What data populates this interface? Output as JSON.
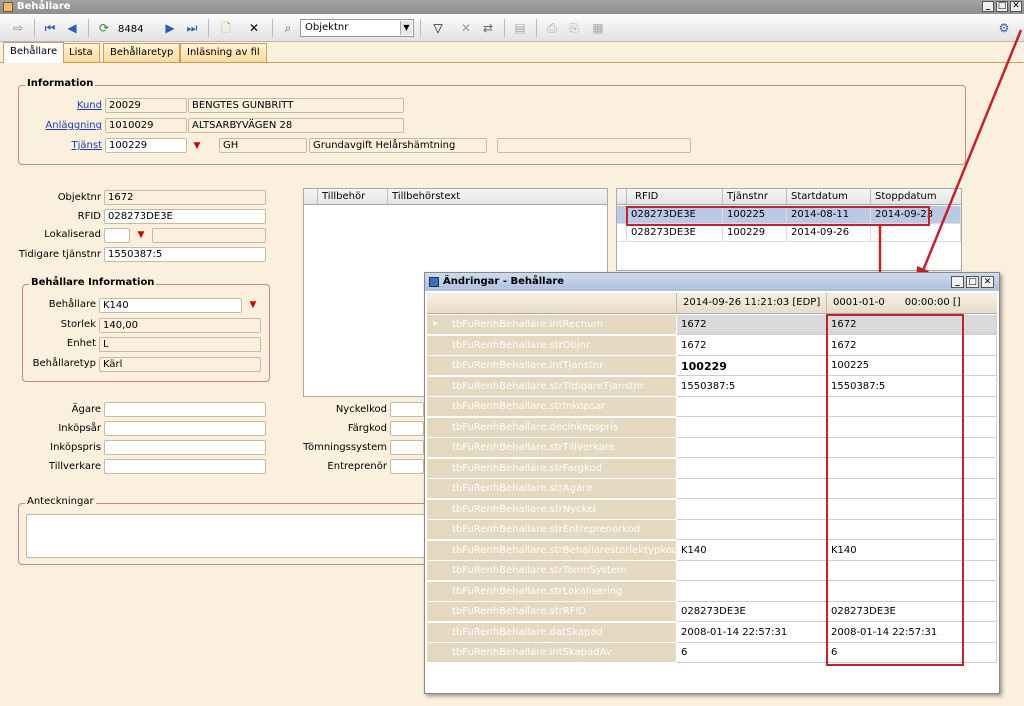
{
  "window": {
    "title": "Behållare"
  },
  "toolbar": {
    "record_number": "8484",
    "search_field": "Objektnr"
  },
  "tabs": [
    {
      "label": "Behållare",
      "active": true
    },
    {
      "label": "Lista"
    },
    {
      "label": "Behållaretyp"
    },
    {
      "label": "Inläsning av fil"
    }
  ],
  "information": {
    "title": "Information",
    "kund_label": "Kund",
    "kund_id": "20029",
    "kund_name": "BENGTES GUNBRITT",
    "anlaggning_label": "Anläggning",
    "anlaggning_id": "1010029",
    "anlaggning_name": "ALTSARBYVÄGEN 28",
    "tjanst_label": "Tjänst",
    "tjanst_id": "100229",
    "tjanst_code": "GH",
    "tjanst_desc": "Grundavgift Helårshämtning",
    "tjanst_extra": ""
  },
  "object": {
    "objektnr_label": "Objektnr",
    "objektnr": "1672",
    "rfid_label": "RFID",
    "rfid": "028273DE3E",
    "lokaliserad_label": "Lokaliserad",
    "lokaliserad": "",
    "lokaliserad_extra": "",
    "tidigare_label": "Tidigare tjänstnr",
    "tidigare": "1550387:5"
  },
  "behallare_info": {
    "title": "Behållare Information",
    "behallare_label": "Behållare",
    "behallare": "K140",
    "storlek_label": "Storlek",
    "storlek": "140,00",
    "enhet_label": "Enhet",
    "enhet": "L",
    "behallaretyp_label": "Behållaretyp",
    "behallaretyp": "Kärl"
  },
  "owner": {
    "agare_label": "Ägare",
    "agare": "",
    "inkopsar_label": "Inköpsår",
    "inkopsar": "",
    "inkopspris_label": "Inköpspris",
    "inkopspris": "",
    "tillverkare_label": "Tillverkare",
    "tillverkare": ""
  },
  "keys": {
    "nyckelkod_label": "Nyckelkod",
    "nyckelkod": "",
    "fargkod_label": "Färgkod",
    "fargkod": "",
    "tomningssystem_label": "Tömningssystem",
    "tomningssystem": "",
    "entreprenor_label": "Entreprenör",
    "entreprenor": ""
  },
  "notes": {
    "label": "Anteckningar",
    "value": ""
  },
  "accessories": {
    "col1": "Tillbehör",
    "col2": "Tillbehörstext"
  },
  "rfid_grid": {
    "headers": [
      "RFID",
      "Tjänstnr",
      "Startdatum",
      "Stoppdatum"
    ],
    "rows": [
      [
        "028273DE3E",
        "100225",
        "2014-08-11",
        "2014-09-23"
      ],
      [
        "028273DE3E",
        "100229",
        "2014-09-26",
        ""
      ]
    ]
  },
  "changes_dialog": {
    "title": "Ändringar - Behållare",
    "col_new": "2014-09-26 11:21:03 [EDP]",
    "col_old": "0001-01-0",
    "col_old_tail": "00:00:00 []",
    "rows": [
      {
        "field": "tbFuRenhBehallare.intRecnum",
        "new": "1672",
        "old": "1672"
      },
      {
        "field": "tbFuRenhBehallare.strObjnr",
        "new": "1672",
        "old": "1672"
      },
      {
        "field": "tbFuRenhBehallare.intTjanstnr",
        "new": "100229",
        "old": "100225"
      },
      {
        "field": "tbFuRenhBehallare.strTidigareTjanstnr",
        "new": "1550387:5",
        "old": "1550387:5"
      },
      {
        "field": "tbFuRenhBehallare.strInkopsar",
        "new": "",
        "old": ""
      },
      {
        "field": "tbFuRenhBehallare.decInkopspris",
        "new": "",
        "old": ""
      },
      {
        "field": "tbFuRenhBehallare.strTillverkare",
        "new": "",
        "old": ""
      },
      {
        "field": "tbFuRenhBehallare.strFargkod",
        "new": "",
        "old": ""
      },
      {
        "field": "tbFuRenhBehallare.strAgare",
        "new": "",
        "old": ""
      },
      {
        "field": "tbFuRenhBehallare.strNyckel",
        "new": "",
        "old": ""
      },
      {
        "field": "tbFuRenhBehallare.strEntreprenorkod",
        "new": "",
        "old": ""
      },
      {
        "field": "tbFuRenhBehallare.strBehallarestorlektypkod",
        "new": "K140",
        "old": "K140"
      },
      {
        "field": "tbFuRenhBehallare.strTomnSystem",
        "new": "",
        "old": ""
      },
      {
        "field": "tbFuRenhBehallare.strLokalisering",
        "new": "",
        "old": ""
      },
      {
        "field": "tbFuRenhBehallare.strRFID",
        "new": "028273DE3E",
        "old": "028273DE3E"
      },
      {
        "field": "tbFuRenhBehallare.datSkapad",
        "new": "2008-01-14 22:57:31",
        "old": "2008-01-14 22:57:31"
      },
      {
        "field": "tbFuRenhBehallare.intSkapadAv",
        "new": "6",
        "old": "6"
      }
    ]
  },
  "colors": {
    "highlight": "#c0232b",
    "panel": "#fbf0de",
    "selection": "#b9c9e6"
  }
}
